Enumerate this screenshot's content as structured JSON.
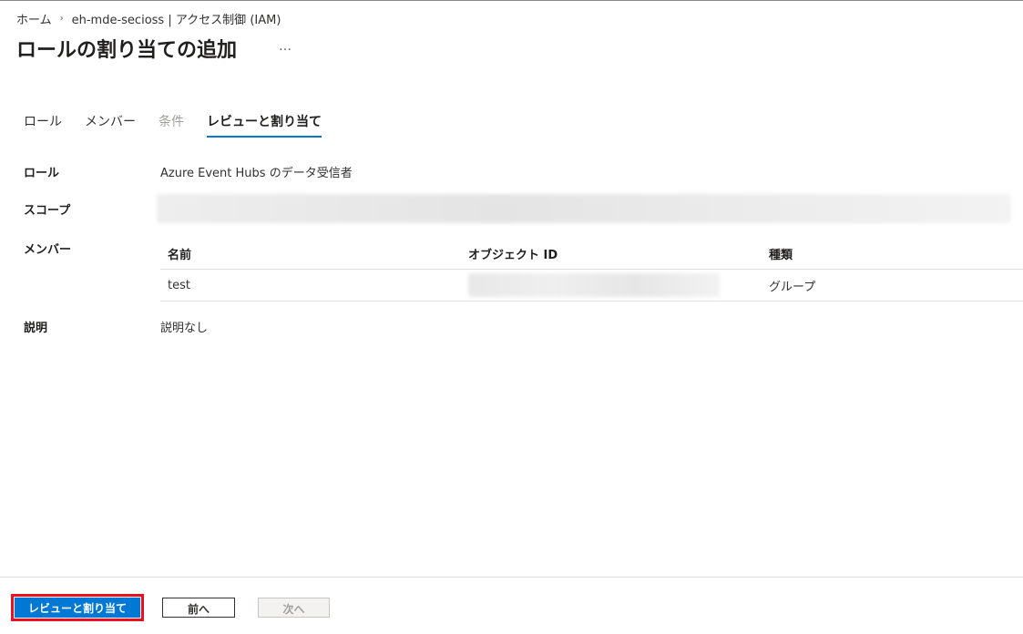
{
  "breadcrumb": {
    "home": "ホーム",
    "separator": "›",
    "parent": "eh-mde-secioss | アクセス制御 (IAM)"
  },
  "header": {
    "title": "ロールの割り当ての追加",
    "more": "…"
  },
  "tabs": [
    {
      "label": "ロール",
      "state": "normal"
    },
    {
      "label": "メンバー",
      "state": "normal"
    },
    {
      "label": "条件",
      "state": "disabled"
    },
    {
      "label": "レビューと割り当て",
      "state": "active"
    }
  ],
  "review": {
    "role_label": "ロール",
    "role_value": "Azure Event Hubs のデータ受信者",
    "scope_label": "スコープ",
    "members_label": "メンバー",
    "members_table": {
      "columns": [
        "名前",
        "オブジェクト ID",
        "種類"
      ],
      "rows": [
        {
          "name": "test",
          "type": "グループ"
        }
      ]
    },
    "description_label": "説明",
    "description_value": "説明なし"
  },
  "footer": {
    "primary": "レビューと割り当て",
    "previous": "前へ",
    "next": "次へ"
  },
  "colors": {
    "accent": "#0078d4",
    "highlight_outline": "#e81123"
  }
}
